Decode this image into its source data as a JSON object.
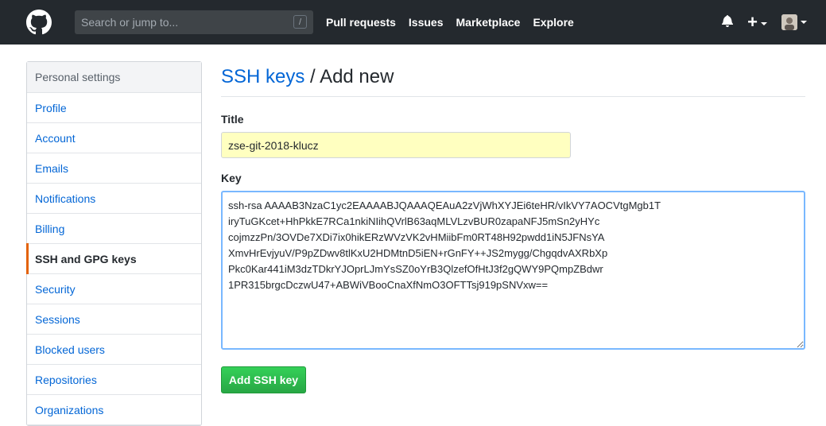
{
  "header": {
    "search_placeholder": "Search or jump to...",
    "search_shortcut": "/",
    "nav": [
      "Pull requests",
      "Issues",
      "Marketplace",
      "Explore"
    ]
  },
  "sidebar": {
    "heading": "Personal settings",
    "items": [
      {
        "label": "Profile"
      },
      {
        "label": "Account"
      },
      {
        "label": "Emails"
      },
      {
        "label": "Notifications"
      },
      {
        "label": "Billing"
      },
      {
        "label": "SSH and GPG keys"
      },
      {
        "label": "Security"
      },
      {
        "label": "Sessions"
      },
      {
        "label": "Blocked users"
      },
      {
        "label": "Repositories"
      },
      {
        "label": "Organizations"
      }
    ],
    "selected_index": 5
  },
  "main": {
    "breadcrumb_link": "SSH keys",
    "breadcrumb_sep": " / ",
    "breadcrumb_current": "Add new",
    "title_label": "Title",
    "title_value": "zse-git-2018-klucz",
    "key_label": "Key",
    "key_value": "ssh-rsa AAAAB3NzaC1yc2EAAAABJQAAAQEAuA2zVjWhXYJEi6teHR/vIkVY7AOCVtgMgb1T\niryTuGKcet+HhPkkE7RCa1nkiNIihQVrlB63aqMLVLzvBUR0zapaNFJ5mSn2yHYc\ncojmzzPn/3OVDe7XDi7ix0hikERzWVzVK2vHMiibFm0RT48H92pwdd1iN5JFNsYA\nXmvHrEvjyuV/P9pZDwv8tlKxU2HDMtnD5iEN+rGnFY++JS2mygg/ChgqdvAXRbXp\nPkc0Kar441iM3dzTDkrYJOprLJmYsSZ0oYrB3QlzefOfHtJ3f2gQWY9PQmpZBdwr\n1PR315brgcDczwU47+ABWiVBooCnaXfNmO3OFTTsj919pSNVxw==",
    "submit_label": "Add SSH key"
  },
  "colors": {
    "header_bg": "#24292e",
    "link": "#0366d6",
    "selected_accent": "#e36209",
    "button_green": "#28a745",
    "autofill_yellow": "#ffffc0"
  }
}
